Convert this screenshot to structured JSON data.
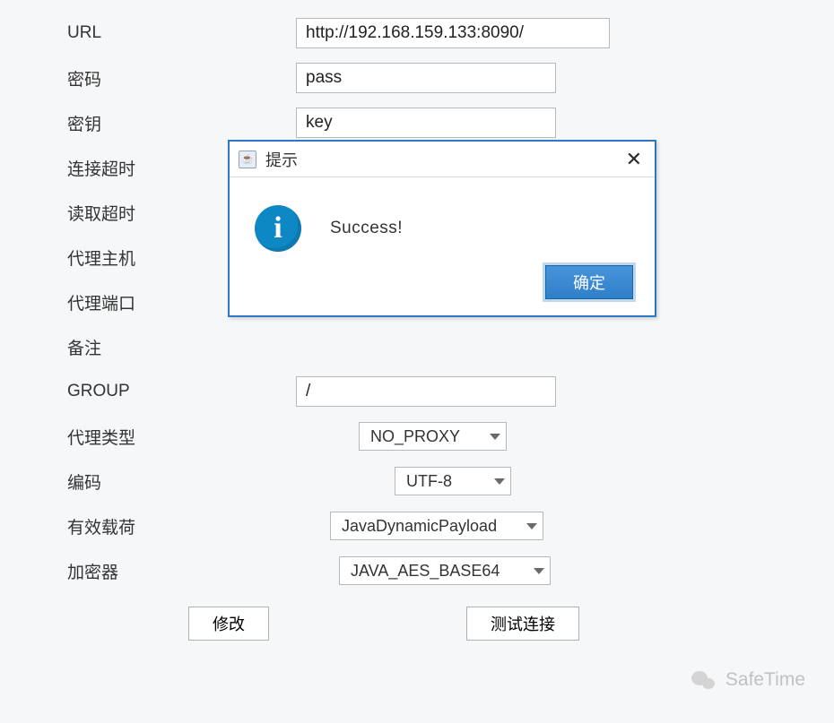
{
  "form": {
    "url": {
      "label": "URL",
      "value": "http://192.168.159.133:8090/"
    },
    "password": {
      "label": "密码",
      "value": "pass"
    },
    "key": {
      "label": "密钥",
      "value": "key"
    },
    "connTimeout": {
      "label": "连接超时"
    },
    "readTimeout": {
      "label": "读取超时"
    },
    "proxyHost": {
      "label": "代理主机"
    },
    "proxyPort": {
      "label": "代理端口"
    },
    "remark": {
      "label": "备注"
    },
    "group": {
      "label": "GROUP",
      "value": "/"
    },
    "proxyType": {
      "label": "代理类型",
      "value": "NO_PROXY"
    },
    "encoding": {
      "label": "编码",
      "value": "UTF-8"
    },
    "payload": {
      "label": "有效载荷",
      "value": "JavaDynamicPayload"
    },
    "encryptor": {
      "label": "加密器",
      "value": "JAVA_AES_BASE64"
    }
  },
  "buttons": {
    "modify": "修改",
    "test": "测试连接"
  },
  "dialog": {
    "title": "提示",
    "java": "☕",
    "message": "Success!",
    "ok": "确定"
  },
  "watermark": {
    "text": "SafeTime"
  }
}
